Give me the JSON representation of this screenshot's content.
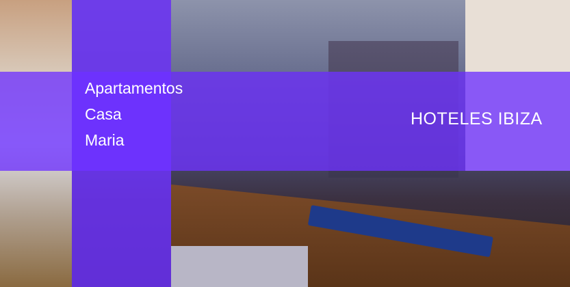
{
  "hotel_name_lines": [
    "Apartamentos",
    "Casa",
    "Maria"
  ],
  "brand": "HOTELES IBIZA",
  "overlay_color": "#6e32ff"
}
